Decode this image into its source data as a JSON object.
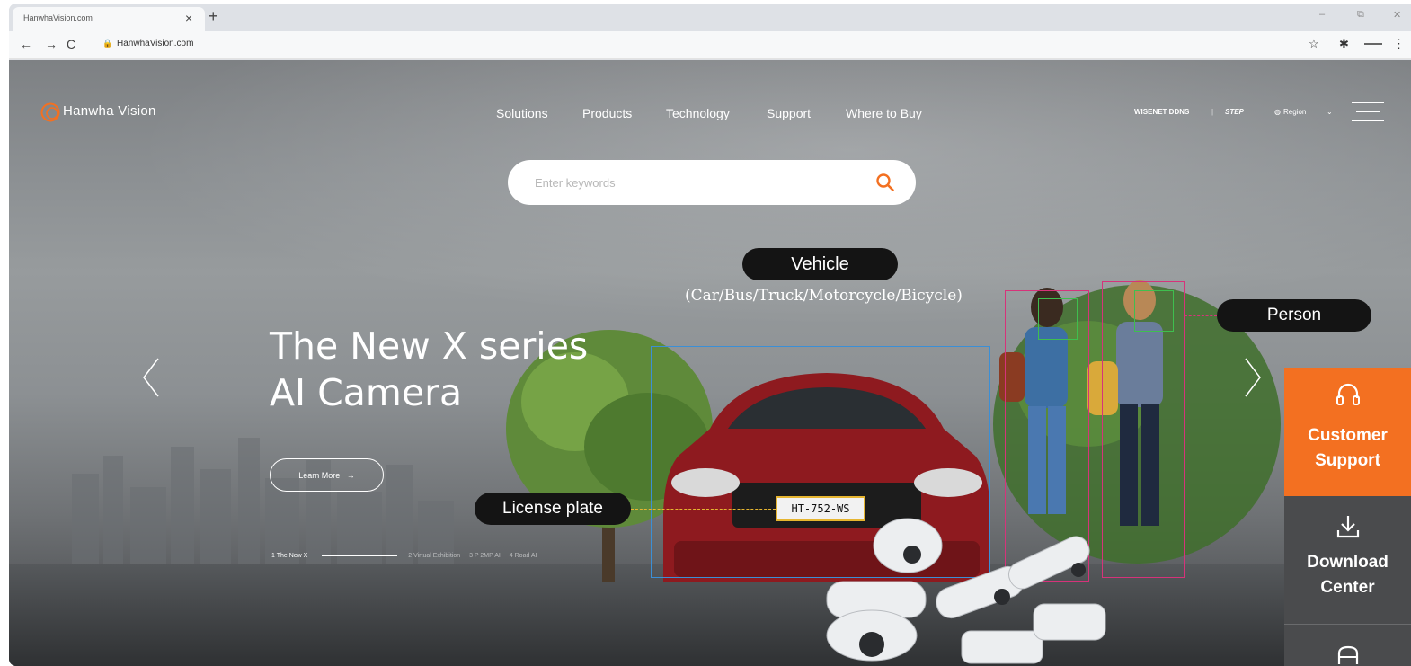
{
  "browser": {
    "tab_title": "HanwhaVision.com",
    "url": "HanwhaVision.com"
  },
  "header": {
    "logo_text": "Hanwha Vision",
    "nav": [
      "Solutions",
      "Products",
      "Technology",
      "Support",
      "Where to Buy"
    ],
    "util_wisenet": "WISENET DDNS",
    "util_sep": "|",
    "util_step": "STEP",
    "util_region": "Region"
  },
  "search": {
    "placeholder": "Enter keywords"
  },
  "hero": {
    "title_line1": "The New X series",
    "title_line2": "AI Camera",
    "button_label": "Learn More",
    "indicators": [
      "1 The New X",
      "2 Virtual Exhibition",
      "3 P 2MP AI",
      "4 Road AI"
    ]
  },
  "ai_labels": {
    "vehicle": "Vehicle",
    "vehicle_sub": "(Car/Bus/Truck/Motorcycle/Bicycle)",
    "person": "Person",
    "license_plate": "License plate",
    "plate_number": "HT-752-WS"
  },
  "side_panel": {
    "customer_support": "Customer Support",
    "download_center": "Download Center"
  },
  "colors": {
    "accent": "#f37021",
    "side_dark": "#4a4b4d",
    "vehicle_box": "#3b8fd6",
    "person_box": "#d6337a",
    "face_box": "#3fbf4f",
    "plate_box": "#e6b530"
  }
}
